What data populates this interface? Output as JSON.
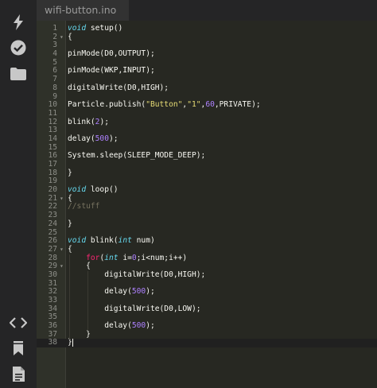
{
  "tab": {
    "filename": "wifi-button.ino"
  },
  "sidebar": {
    "icons": [
      "flash-icon",
      "verify-check-icon",
      "folder-icon",
      "code-icon",
      "bookmark-icon",
      "document-icon"
    ]
  },
  "code": {
    "lines": [
      {
        "n": "1",
        "fold": "",
        "html": "<span class=\"kw\">void</span> setup()"
      },
      {
        "n": "2",
        "fold": "▾",
        "html": "{"
      },
      {
        "n": "3",
        "fold": "",
        "html": ""
      },
      {
        "n": "4",
        "fold": "",
        "html": "pinMode(D0,OUTPUT);"
      },
      {
        "n": "5",
        "fold": "",
        "html": ""
      },
      {
        "n": "6",
        "fold": "",
        "html": "pinMode(WKP,INPUT);"
      },
      {
        "n": "7",
        "fold": "",
        "html": ""
      },
      {
        "n": "8",
        "fold": "",
        "html": "digitalWrite(D0,HIGH);"
      },
      {
        "n": "9",
        "fold": "",
        "html": ""
      },
      {
        "n": "10",
        "fold": "",
        "html": "Particle.publish(<span class=\"str\">\"Button\"</span>,<span class=\"str\">\"1\"</span>,<span class=\"num\">60</span>,PRIVATE);"
      },
      {
        "n": "11",
        "fold": "",
        "html": ""
      },
      {
        "n": "12",
        "fold": "",
        "html": "blink(<span class=\"num\">2</span>);"
      },
      {
        "n": "13",
        "fold": "",
        "html": ""
      },
      {
        "n": "14",
        "fold": "",
        "html": "delay(<span class=\"num\">500</span>);"
      },
      {
        "n": "15",
        "fold": "",
        "html": ""
      },
      {
        "n": "16",
        "fold": "",
        "html": "System.sleep(SLEEP_MODE_DEEP);"
      },
      {
        "n": "17",
        "fold": "",
        "html": ""
      },
      {
        "n": "18",
        "fold": "",
        "html": "}"
      },
      {
        "n": "19",
        "fold": "",
        "html": ""
      },
      {
        "n": "20",
        "fold": "",
        "html": "<span class=\"kw\">void</span> loop()"
      },
      {
        "n": "21",
        "fold": "▾",
        "html": "{"
      },
      {
        "n": "22",
        "fold": "",
        "html": "<span class=\"cmt\">//stuff</span>"
      },
      {
        "n": "23",
        "fold": "",
        "html": ""
      },
      {
        "n": "24",
        "fold": "",
        "html": "}"
      },
      {
        "n": "25",
        "fold": "",
        "html": ""
      },
      {
        "n": "26",
        "fold": "",
        "html": "<span class=\"kw\">void</span> blink(<span class=\"kw\">int</span> num)"
      },
      {
        "n": "27",
        "fold": "▾",
        "html": "{"
      },
      {
        "n": "28",
        "fold": "",
        "html": "    <span class=\"kw2\">for</span>(<span class=\"kw\">int</span> i=<span class=\"num\">0</span>;i&lt;num;i++)"
      },
      {
        "n": "29",
        "fold": "▾",
        "html": "    {"
      },
      {
        "n": "30",
        "fold": "",
        "html": "        digitalWrite(D0,HIGH);"
      },
      {
        "n": "31",
        "fold": "",
        "html": ""
      },
      {
        "n": "32",
        "fold": "",
        "html": "        delay(<span class=\"num\">500</span>);"
      },
      {
        "n": "33",
        "fold": "",
        "html": ""
      },
      {
        "n": "34",
        "fold": "",
        "html": "        digitalWrite(D0,LOW);"
      },
      {
        "n": "35",
        "fold": "",
        "html": ""
      },
      {
        "n": "36",
        "fold": "",
        "html": "        delay(<span class=\"num\">500</span>);"
      },
      {
        "n": "37",
        "fold": "",
        "html": "    }"
      },
      {
        "n": "38",
        "fold": "",
        "html": "}"
      }
    ],
    "active_line": "38"
  }
}
